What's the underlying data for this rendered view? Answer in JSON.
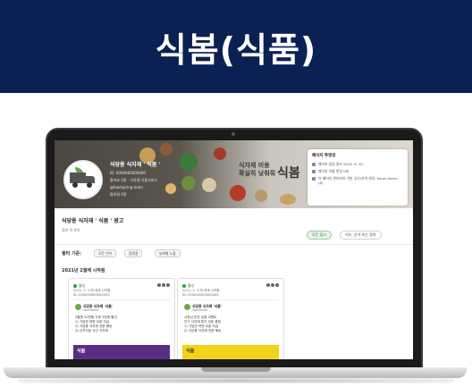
{
  "banner": {
    "title": "식봄(식품)"
  },
  "cover": {
    "page_name": "식당용 식자재 ' 식봄 '",
    "info_lines": [
      "ID: 0000000000000",
      "좋아요 0명 · 식자재 식품서비스",
      "@foodspring.team",
      "팔로워 0명"
    ],
    "slogan_lines": [
      "식자재 비용",
      "확실히 낮춰줘"
    ],
    "logo_text": "식봄"
  },
  "transparency": {
    "title": "페이지 투명성",
    "rows": [
      "페이지 생성 일자 2018. 8. 30.",
      "페이지 이름 변경 0회",
      "이 페이지 관리자의 기본 국가/지역 위치: South Korea (8)"
    ]
  },
  "library": {
    "title": "식당용 식자재 ' 식봄 ' 광고",
    "result_count": "결과 약 0개",
    "active_button": "모든 광고",
    "inactive_button": "이슈, 선거 또는 정치",
    "filter_label": "필터 기준:",
    "filters": [
      "모든 언어",
      "플랫폼",
      "날짜별 노출"
    ],
    "section_label": "2021년 2월에 시작됨"
  },
  "cards": [
    {
      "status": "활성",
      "date": "2021. 2. 1.에 게재 시작함",
      "id": "ID: 000000000000000",
      "page_name": "식당용 식자재 '식봄'",
      "sponsored": "Sponsored",
      "body_lines": [
        "2월엔 20만원 주문 2만원 할인",
        "1) 가입만 하면 쿠폰 지급",
        "2) 식당용 식자재 전문 배송",
        "3) 산지직송 신선 식자재"
      ],
      "image_text": "식봄",
      "image_color": "#5a2d82"
    },
    {
      "status": "활성",
      "date": "2021. 2. 3.에 게재 시작함",
      "id": "ID: 000000000000000",
      "page_name": "식당용 식자재 '식봄'",
      "sponsored": "Sponsored",
      "body_lines": [
        "사장님 반찬 입점 이벤트",
        "인기 식자재 특가 쿠폰 증정",
        "1) 가입만 하면 쿠폰 지급",
        "2) 식당용 식자재 전문 배송"
      ],
      "image_text": "식봄",
      "image_color": "#f2d318"
    }
  ],
  "colors": {
    "banner_bg": "#0c2153",
    "accent_green": "#2e7d32"
  }
}
